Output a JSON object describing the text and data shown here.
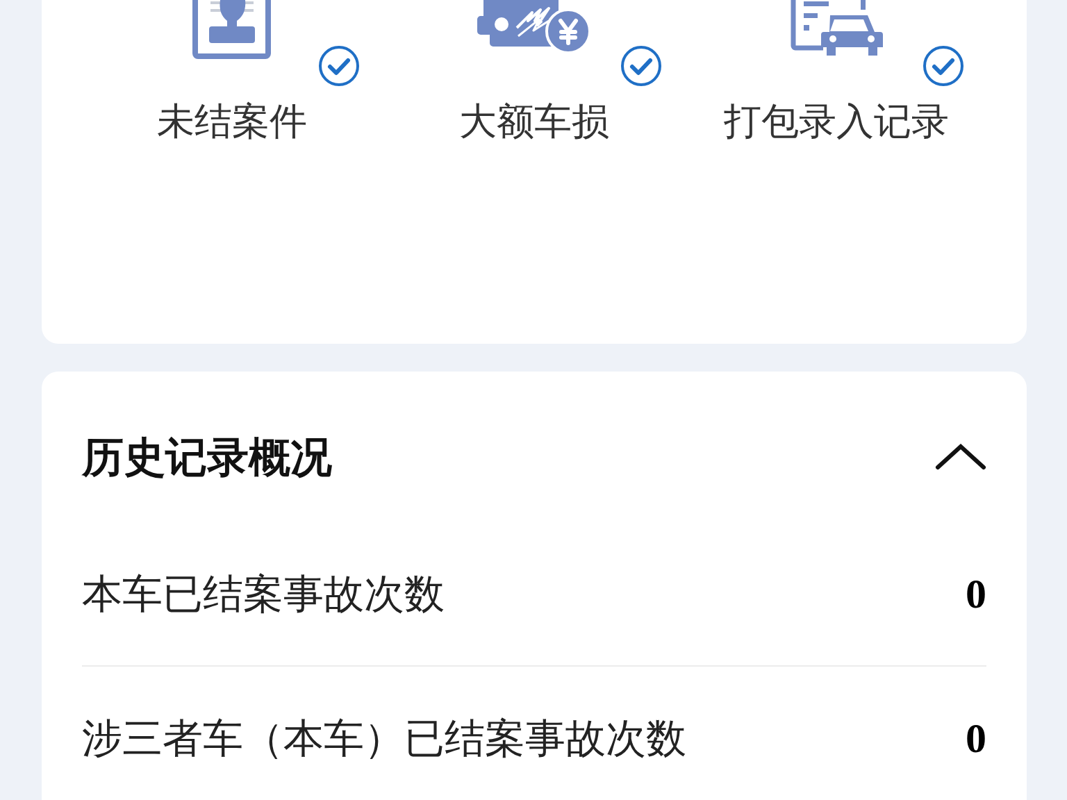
{
  "shortcuts": [
    {
      "kind": "stamp",
      "label": "未结案件",
      "checked": true
    },
    {
      "kind": "claim",
      "label": "大额车损",
      "checked": true
    },
    {
      "kind": "vehicle",
      "label": "打包录入记录",
      "checked": true
    }
  ],
  "history_panel": {
    "title": "历史记录概况",
    "expanded": true,
    "rows": [
      {
        "label": "本车已结案事故次数",
        "value": "0"
      },
      {
        "label": "涉三者车（本车）已结案事故次数",
        "value": "0"
      }
    ]
  }
}
